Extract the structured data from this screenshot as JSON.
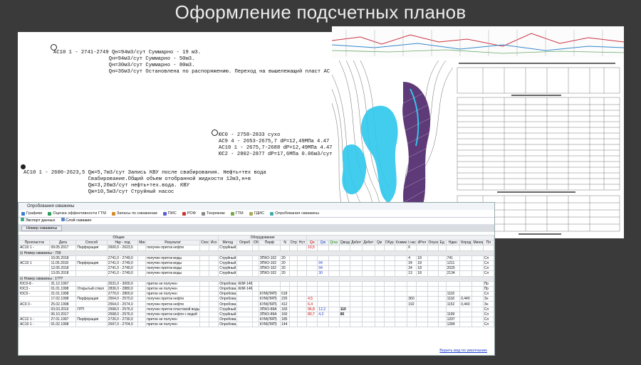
{
  "page_title": "Оформление подсчетных планов",
  "annotations": {
    "block1": "АС10 1 - 2741-2749 Qн=94м3/сут Суммарно - 19 м3.\n                  Qн=94м3/сут Суммарно - 50м3.\n                  Qн=30м3/сут Суммарно - 80м3.\n                  Qн=36м3/сут Остановлена по распоряжению. Переход на вышележащий пласт АС",
    "block2": "ЮС0 - 2758-2833 сухо\nАС9 4 - 2653-2675,7 dP=12,49МПа 4.47\nАС10 1 - 2675,7-2688 dP=12,49МПа 4.47\nЮС2 - 2802-2877 dP=17,6МПа 0.06м3/сут",
    "block3": "АС10 1 - 2600-2623,5 Qж=5,7м3/сут Запись КВУ после свабирования. Нефть+тех вода\n                     Свабирование.Общий объем отобранной жидкости 12м3,н+в\n                     Qж=3,26м3/сут нефть+тех.вода. КВУ\n                     Qж=10,5м3/сут Струйный насос"
  },
  "app": {
    "window_title": "Опробования скважины",
    "tabs": [
      {
        "label": "Графики",
        "icon": "chart-icon"
      },
      {
        "label": "Оценка эффективности ГТМ",
        "icon": "gauge-icon"
      },
      {
        "label": "Запасы по скважинам",
        "icon": "reserves-icon"
      },
      {
        "label": "ПИС",
        "icon": "pis-icon"
      },
      {
        "label": "РОФ",
        "icon": "rof-icon"
      },
      {
        "label": "Текрежим",
        "icon": "mode-icon"
      },
      {
        "label": "ГТМ",
        "icon": "gtm-icon"
      },
      {
        "label": "ГДИС",
        "icon": "gdis-icon"
      },
      {
        "label": "Опробования скважины",
        "icon": "test-icon"
      }
    ],
    "toolbar": {
      "export": "Экспорт данных",
      "layers": "Слой скважин"
    },
    "filter_label": "Номер скважины",
    "group_headers": {
      "common": "Общие",
      "equipment": "Оборудование"
    },
    "columns": [
      "Пропласток",
      "Дата",
      "Способ",
      "Нкр - под",
      "Мин",
      "Результат",
      "Спос",
      "Исх",
      "Метод",
      "Опроб",
      "Оборудование",
      "Перф",
      "N",
      "Dтр",
      "Нст",
      "Qн",
      "Qж",
      "Qгаз",
      "Qвода",
      "Дебит",
      "Дебит с",
      "Qж",
      "Обур",
      "Коммент",
      "t,час",
      "dРпл",
      "Опуск",
      "Ед",
      "Ндин",
      "Кпрод",
      "Минер",
      "Пл"
    ],
    "header_colors": {
      "Qн": "red",
      "Qж": "blue",
      "Qгаз": "green"
    },
    "rows": [
      {
        "type": "row",
        "c": [
          "АС10 1 -",
          "09.05.2017",
          "Перфорация",
          "2600,0 - 2623,5",
          "",
          "получен приток нефти",
          "",
          "",
          "Струйный",
          "",
          "",
          "",
          "",
          "",
          "",
          "10,5",
          "",
          "",
          "",
          "",
          "",
          "",
          "",
          "",
          "6",
          "",
          "",
          "",
          "",
          "",
          "",
          ""
        ],
        "qn": true
      },
      {
        "type": "group",
        "label": "Номер скважины : 709"
      },
      {
        "type": "row",
        "c": [
          "",
          "10.05.2018",
          "",
          "2741,0 - 2749,0",
          "",
          "получен приток воды",
          "",
          "",
          "Струйный",
          "",
          "",
          "ЗПКО-102",
          "20",
          "",
          "",
          "",
          "",
          "",
          "",
          "",
          "",
          "",
          "",
          "",
          "4",
          "18",
          "",
          "",
          "741",
          "",
          "",
          "Сл"
        ]
      },
      {
        "type": "row",
        "c": [
          "АС10 1",
          "11.05.2018",
          "Перфорация",
          "2741,0 - 2749,0",
          "",
          "получен приток воды",
          "",
          "",
          "Струйный",
          "",
          "",
          "ЗПКО-102",
          "20",
          "",
          "",
          "",
          "94",
          "",
          "",
          "",
          "",
          "",
          "",
          "",
          "24",
          "18",
          "",
          "",
          "1211",
          "",
          "",
          "Сл"
        ]
      },
      {
        "type": "row",
        "c": [
          "",
          "12.05.2018",
          "",
          "2741,0 - 2749,0",
          "",
          "получен приток воды",
          "",
          "",
          "Струйный",
          "",
          "",
          "ЗПКО-102",
          "20",
          "",
          "",
          "",
          "94",
          "",
          "",
          "",
          "",
          "",
          "",
          "",
          "24",
          "18",
          "",
          "",
          "2025",
          "",
          "",
          "Сл"
        ]
      },
      {
        "type": "row",
        "c": [
          "",
          "13.05.2018",
          "",
          "2741,0 - 2749,0",
          "",
          "получен приток воды",
          "",
          "",
          "Струйный",
          "",
          "",
          "ЗПКО-102",
          "20",
          "",
          "",
          "",
          "30",
          "",
          "",
          "",
          "",
          "",
          "",
          "",
          "13",
          "18",
          "",
          "",
          "2134",
          "",
          "",
          "Сл"
        ]
      },
      {
        "type": "group",
        "label": "Номер скважины : 1???"
      },
      {
        "type": "row",
        "c": [
          "ЮС0-8 -",
          "31.12.1997",
          "",
          "2631,0 - 3000,0",
          "",
          "приток не получен",
          "",
          "",
          "Опробова",
          "КИИ-146",
          "",
          "",
          "",
          "",
          "",
          "",
          "",
          "",
          "",
          "",
          "",
          "",
          "",
          "",
          "",
          "",
          "",
          "",
          "",
          "",
          "",
          "Пр"
        ]
      },
      {
        "type": "row",
        "c": [
          "ЮС3 -",
          "01.01.1998",
          "Открытый ствол",
          "2836,0 - 2880,0",
          "",
          "приток не получен",
          "",
          "",
          "Опробова",
          "КИИ-146",
          "",
          "",
          "",
          "",
          "",
          "",
          "",
          "",
          "",
          "",
          "",
          "",
          "",
          "",
          "",
          "",
          "",
          "",
          "",
          "",
          "",
          "Пр"
        ]
      },
      {
        "type": "row",
        "c": [
          "ЮС0 -",
          "21.01.1998",
          "",
          "2770,0 - 2800,0",
          "",
          "приток не получен",
          "",
          "",
          "Опробова",
          "",
          "",
          "КУМ(ЛЯП)",
          "618",
          "",
          "",
          "",
          "",
          "",
          "",
          "",
          "",
          "",
          "",
          "",
          "",
          "",
          "",
          "",
          "1118",
          "",
          "",
          "Сл"
        ]
      },
      {
        "type": "row",
        "c": [
          "",
          "17.02.1998",
          "Перфорация",
          "2564,0 - 2570,0",
          "",
          "получен приток нефти",
          "",
          "",
          "Опробова",
          "",
          "",
          "КУМ(ЛЯП)",
          "226",
          "",
          "",
          "4,5",
          "",
          "",
          "",
          "",
          "",
          "",
          "",
          "",
          "360",
          "",
          "",
          "",
          "1118",
          "0,440",
          "",
          "Зн"
        ]
      },
      {
        "type": "row",
        "c": [
          "АС9 3 -",
          "25.02.1998",
          "",
          "2564,0 - 2574,0",
          "",
          "получен приток нефти",
          "",
          "",
          "Опробова",
          "",
          "",
          "КУМ(ЛЯП)",
          "412",
          "",
          "",
          "6,4",
          "",
          "",
          "",
          "",
          "",
          "",
          "",
          "",
          "192",
          "",
          "",
          "",
          "1152",
          "0,440",
          "",
          "Зн"
        ]
      },
      {
        "type": "row",
        "c": [
          "",
          "03.03.2016",
          "ГРП",
          "2568,0 - 2576,0",
          "",
          "получен приток пластовой воды с нефтью",
          "",
          "",
          "Струйный",
          "",
          "",
          "ЗПКО-89А",
          "160",
          "",
          "",
          "96,8",
          "12,2",
          "",
          "110",
          "",
          "",
          "",
          "",
          "",
          "",
          "",
          "",
          "",
          "",
          "",
          "",
          "Сл"
        ]
      },
      {
        "type": "row",
        "c": [
          "",
          "06.10.2017",
          "",
          "2568,0 - 2576,0",
          "",
          "получен приток нефти с водой",
          "",
          "",
          "Струйный",
          "",
          "",
          "ЗПКО-89А",
          "160",
          "",
          "",
          "80,7",
          "4,3",
          "",
          "85",
          "",
          "",
          "",
          "",
          "",
          "",
          "",
          "",
          "",
          "1199",
          "",
          "",
          "Сл"
        ]
      },
      {
        "type": "row",
        "c": [
          "АС12 1 -",
          "27.01.1997",
          "Перфорация",
          "2726,0 - 2730,0",
          "",
          "приток не получен",
          "",
          "",
          "Опробова",
          "",
          "",
          "КУМ(ЛЯП)",
          "185",
          "",
          "",
          "",
          "",
          "",
          "",
          "",
          "",
          "",
          "",
          "",
          "",
          "",
          "",
          "",
          "1297",
          "",
          "",
          "Сл"
        ]
      },
      {
        "type": "row",
        "c": [
          "АС10 1 -",
          "01.02.1998",
          "",
          "2697,0 - 2704,0",
          "",
          "приток не получен",
          "",
          "",
          "Опробова",
          "",
          "",
          "КУМ(ЛЯП)",
          "144",
          "",
          "",
          "",
          "",
          "",
          "",
          "",
          "",
          "",
          "",
          "",
          "",
          "",
          "",
          "",
          "1284",
          "",
          "",
          "Сл"
        ]
      }
    ],
    "footer_link": "Верить вид по умолчанию"
  },
  "colors": {
    "accent_red": "#c00000",
    "accent_blue": "#1a3ccc",
    "accent_green": "#0a8a0a",
    "map_cyan": "#2ec6ec",
    "map_purple": "#5e3a78"
  }
}
